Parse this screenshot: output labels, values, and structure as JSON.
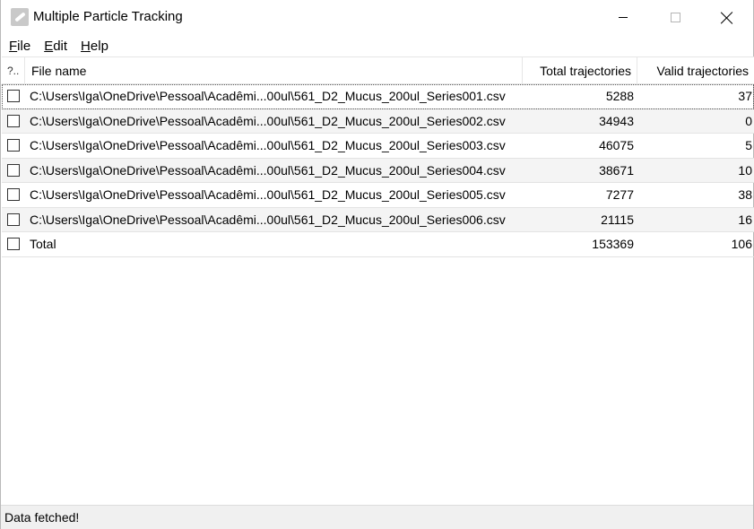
{
  "window": {
    "title": "Multiple Particle Tracking",
    "icon": "feather-icon"
  },
  "menu": {
    "items": [
      {
        "accel": "F",
        "rest": "ile"
      },
      {
        "accel": "E",
        "rest": "dit"
      },
      {
        "accel": "H",
        "rest": "elp"
      }
    ]
  },
  "table": {
    "headers": {
      "check": "?..",
      "name": "File name",
      "total": "Total trajectories",
      "valid": "Valid trajectories"
    },
    "rows": [
      {
        "name": "C:\\Users\\Iga\\OneDrive\\Pessoal\\Acadêmi...00ul\\561_D2_Mucus_200ul_Series001.csv",
        "total": "5288",
        "valid": "37",
        "checked": false
      },
      {
        "name": "C:\\Users\\Iga\\OneDrive\\Pessoal\\Acadêmi...00ul\\561_D2_Mucus_200ul_Series002.csv",
        "total": "34943",
        "valid": "0",
        "checked": false
      },
      {
        "name": "C:\\Users\\Iga\\OneDrive\\Pessoal\\Acadêmi...00ul\\561_D2_Mucus_200ul_Series003.csv",
        "total": "46075",
        "valid": "5",
        "checked": false
      },
      {
        "name": "C:\\Users\\Iga\\OneDrive\\Pessoal\\Acadêmi...00ul\\561_D2_Mucus_200ul_Series004.csv",
        "total": "38671",
        "valid": "10",
        "checked": false
      },
      {
        "name": "C:\\Users\\Iga\\OneDrive\\Pessoal\\Acadêmi...00ul\\561_D2_Mucus_200ul_Series005.csv",
        "total": "7277",
        "valid": "38",
        "checked": false
      },
      {
        "name": "C:\\Users\\Iga\\OneDrive\\Pessoal\\Acadêmi...00ul\\561_D2_Mucus_200ul_Series006.csv",
        "total": "21115",
        "valid": "16",
        "checked": false
      }
    ],
    "total_row": {
      "name": "Total",
      "total": "153369",
      "valid": "106",
      "checked": false
    }
  },
  "status": {
    "text": "Data fetched!"
  }
}
